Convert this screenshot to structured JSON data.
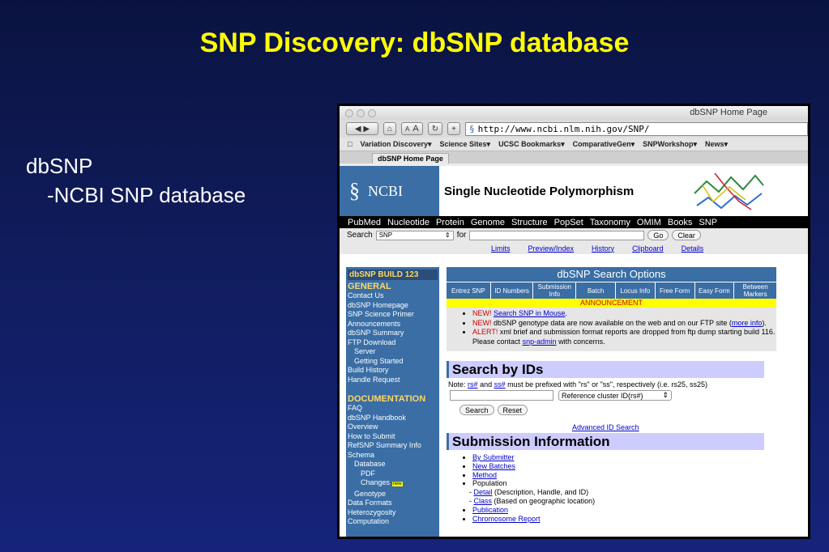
{
  "slide": {
    "title": "SNP Discovery:  dbSNP database",
    "bullet1": "dbSNP",
    "bullet2": "-NCBI SNP database"
  },
  "browser": {
    "window_title": "dbSNP Home Page",
    "url": "http://www.ncbi.nlm.nih.gov/SNP/",
    "toolbar": {
      "text_small": "A",
      "text_large": "A"
    },
    "bookmarks": [
      "Variation Discovery▾",
      "Science Sites▾",
      "UCSC Bookmarks▾",
      "ComparativeGen▾",
      "SNPWorkshop▾",
      "News▾"
    ],
    "tab": "dbSNP Home Page"
  },
  "ncbi": {
    "logo_text": "NCBI",
    "page_heading": "Single Nucleotide Polymorphism",
    "nav": [
      "PubMed",
      "Nucleotide",
      "Protein",
      "Genome",
      "Structure",
      "PopSet",
      "Taxonomy",
      "OMIM",
      "Books",
      "SNP"
    ],
    "search_label": "Search",
    "search_db": "SNP",
    "for_label": "for",
    "go": "Go",
    "clear": "Clear",
    "links": [
      "Limits",
      "Preview/Index",
      "History",
      "Clipboard",
      "Details"
    ]
  },
  "sidebar": {
    "build": "dbSNP BUILD 123",
    "general": "GENERAL",
    "general_items": [
      "Contact Us",
      "dbSNP Homepage",
      "SNP Science Primer",
      "Announcements",
      "dbSNP Summary",
      "FTP Download"
    ],
    "ftp_sub": [
      "Server",
      "Getting Started"
    ],
    "general_items2": [
      "Build History",
      "Handle Request"
    ],
    "documentation": "DOCUMENTATION",
    "doc_items": [
      "FAQ",
      "dbSNP Handbook",
      "Overview",
      "How to Submit",
      "RefSNP Summary Info",
      "Schema"
    ],
    "database": "Database",
    "pdf": "PDF",
    "changes": "Changes",
    "new_tag": "new",
    "genotype": "Genotype",
    "doc_items2": [
      "Data Formats",
      "Heterozygosity",
      "Computation"
    ]
  },
  "search_options": {
    "title": "dbSNP Search Options",
    "tabs": [
      "Entrez SNP",
      "ID Numbers",
      "Submission Info",
      "Batch",
      "Locus Info",
      "Free Form",
      "Easy Form",
      "Between Markers"
    ],
    "announcement": "ANNOUNCEMENT",
    "new1": "NEW!",
    "new1_link": "Search SNP in Mouse",
    "new2": "NEW!",
    "new2_text": "dbSNP genotype data are now available on the web and on our FTP site",
    "new2_link": "more info",
    "alert": "ALERT!",
    "alert_text": "xml brief and submission format reports are dropped from ftp dump starting build 116. Please contact",
    "alert_link": "snp-admin",
    "alert_tail": "with concerns."
  },
  "search_ids": {
    "title": "Search by IDs",
    "note_prefix": "Note:",
    "rs": "rs#",
    "and": "and",
    "ss": "ss#",
    "note_suffix": "must be prefixed with \"rs\" or \"ss\", respectively (i.e. rs25, ss25)",
    "select": "Reference cluster ID(rs#)",
    "search": "Search",
    "reset": "Reset",
    "advanced": "Advanced ID Search"
  },
  "submission": {
    "title": "Submission Information",
    "items": [
      "By Submitter",
      "New Batches",
      "Method"
    ],
    "population": "Population",
    "detail": "Detail",
    "detail_desc": "(Description, Handle, and ID)",
    "class": "Class",
    "class_desc": "(Based on geographic location)",
    "items2": [
      "Publication",
      "Chromosome Report"
    ]
  }
}
